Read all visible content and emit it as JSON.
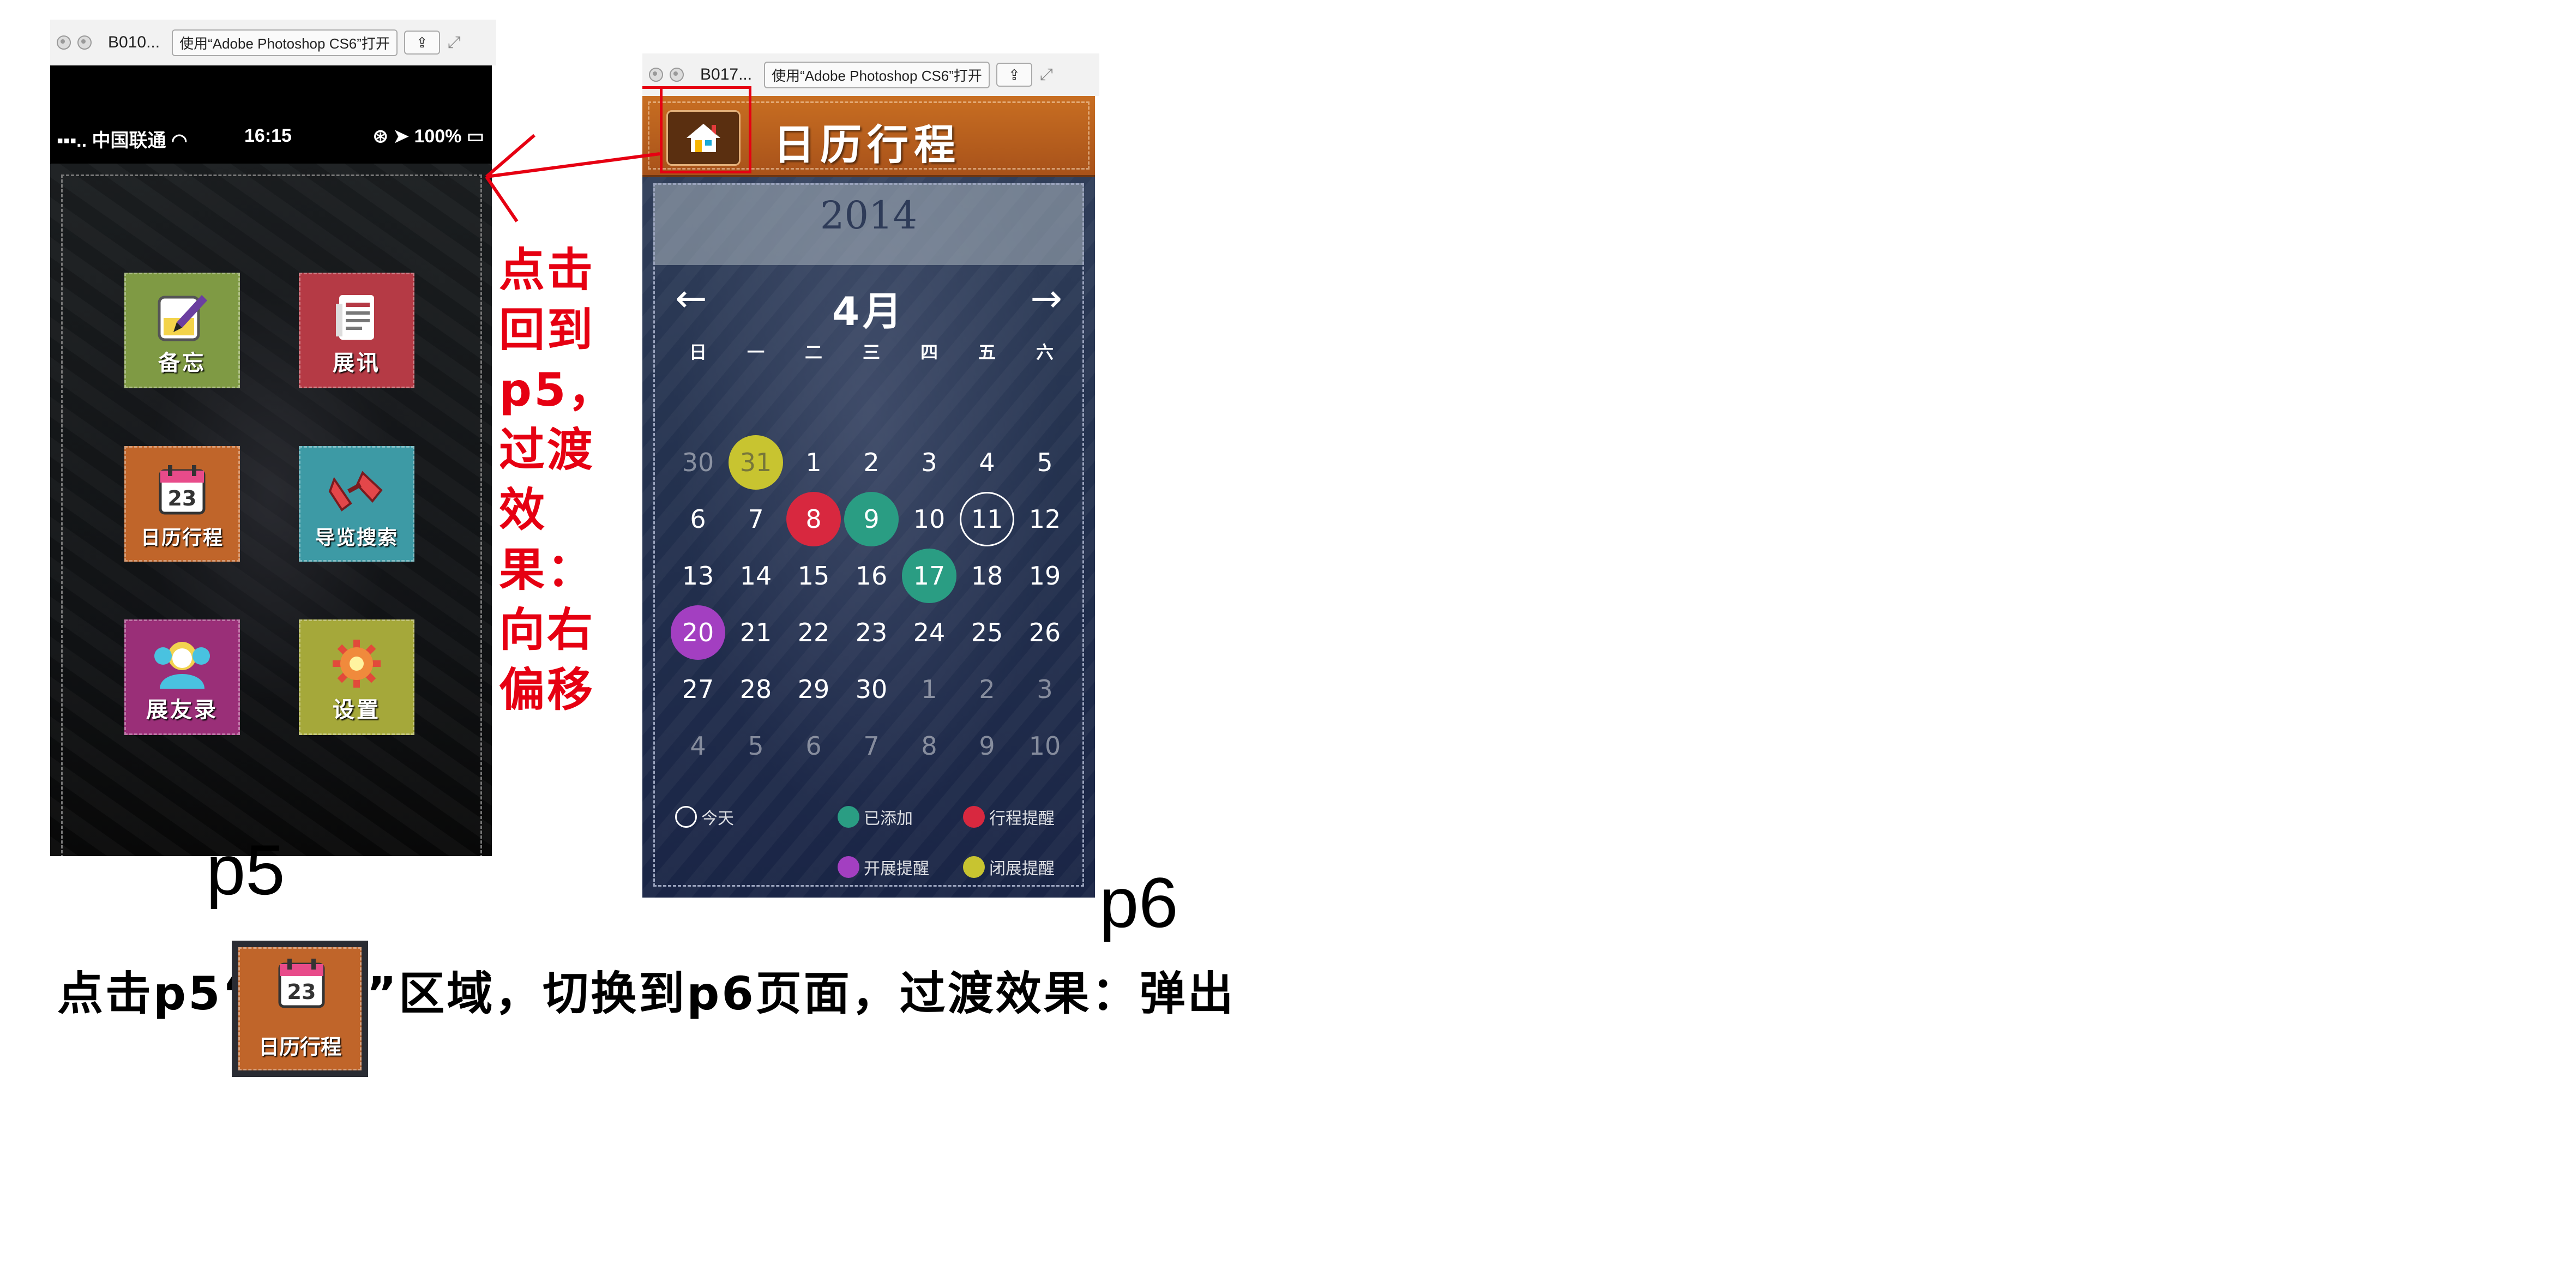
{
  "p5_window": {
    "filename": "B010...",
    "open_with": "使用“Adobe Photoshop CS6”打开",
    "status": {
      "carrier": "▪▪▪.. 中国联通",
      "time": "16:15",
      "battery": "100%"
    },
    "tiles": [
      {
        "label": "备忘",
        "color": "#7f9a44",
        "icon": "memo-icon"
      },
      {
        "label": "展讯",
        "color": "#b53a45",
        "icon": "news-icon"
      },
      {
        "label": "日历行程",
        "color": "#c0652a",
        "icon": "calendar-icon",
        "icon_text": "23"
      },
      {
        "label": "导览搜索",
        "color": "#3d9aa5",
        "icon": "glasses-icon"
      },
      {
        "label": "展友录",
        "color": "#9a2f78",
        "icon": "contacts-icon"
      },
      {
        "label": "设置",
        "color": "#a5a83a",
        "icon": "gear-icon"
      }
    ],
    "page_label": "p5"
  },
  "p6_window": {
    "filename": "B017...",
    "open_with": "使用“Adobe Photoshop CS6”打开",
    "header_title": "日历行程",
    "year": "2014",
    "month": "4月",
    "weekdays": [
      "日",
      "一",
      "二",
      "三",
      "四",
      "五",
      "六"
    ],
    "weeks": [
      [
        "30",
        "31",
        "1",
        "2",
        "3",
        "4",
        "5"
      ],
      [
        "6",
        "7",
        "8",
        "9",
        "10",
        "11",
        "12"
      ],
      [
        "13",
        "14",
        "15",
        "16",
        "17",
        "18",
        "19"
      ],
      [
        "20",
        "21",
        "22",
        "23",
        "24",
        "25",
        "26"
      ],
      [
        "27",
        "28",
        "29",
        "30",
        "1",
        "2",
        "3"
      ],
      [
        "4",
        "5",
        "6",
        "7",
        "8",
        "9",
        "10"
      ]
    ],
    "marked_days": [
      {
        "week": 0,
        "day": 1,
        "type": "close"
      },
      {
        "week": 1,
        "day": 2,
        "type": "reminder"
      },
      {
        "week": 1,
        "day": 3,
        "type": "added"
      },
      {
        "week": 1,
        "day": 5,
        "type": "today"
      },
      {
        "week": 2,
        "day": 4,
        "type": "added"
      },
      {
        "week": 3,
        "day": 0,
        "type": "open"
      }
    ],
    "legend": {
      "today": "今天",
      "added": "已添加",
      "reminder": "行程提醒",
      "open": "开展提醒",
      "close": "闭展提醒"
    },
    "colors": {
      "today": "#ffffff",
      "added": "#2a9d83",
      "reminder": "#d8283f",
      "open": "#a33fc1",
      "close": "#c8c430"
    },
    "page_label": "p6"
  },
  "annotations": {
    "back_note": "点击回到p5，过渡效果：向右偏移",
    "bottom_prefix": "点击p5“",
    "bottom_suffix": "”区域，切换到p6页面，过渡效果：弹出",
    "thumb_label": "日历行程",
    "thumb_number": "23",
    "accent": "#e60012"
  }
}
